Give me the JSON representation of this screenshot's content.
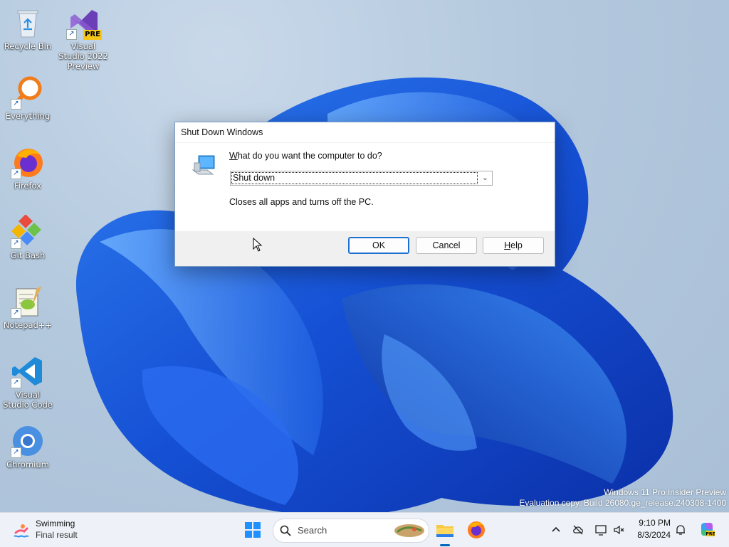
{
  "desktop": {
    "icons": [
      {
        "label": "Recycle Bin"
      },
      {
        "label": "Visual Studio 2022 Preview",
        "badge": "PRE"
      },
      {
        "label": "Everything"
      },
      {
        "label": "Firefox"
      },
      {
        "label": "Git Bash"
      },
      {
        "label": "Notepad++"
      },
      {
        "label": "Visual Studio Code"
      },
      {
        "label": "Chromium"
      }
    ]
  },
  "dialog": {
    "title": "Shut Down Windows",
    "prompt_pre": "W",
    "prompt_rest": "hat do you want the computer to do?",
    "selected_option": "Shut down",
    "description": "Closes all apps and turns off the PC.",
    "ok_label": "OK",
    "cancel_label": "Cancel",
    "help_label_ul": "H",
    "help_label_rest": "elp"
  },
  "watermark": {
    "line1": "Windows 11 Pro Insider Preview",
    "line2": "Evaluation copy. Build 26080.ge_release.240308-1400"
  },
  "taskbar": {
    "weather_title": "Swimming",
    "weather_subtitle": "Final result",
    "search_placeholder": "Search",
    "clock_time": "9:10 PM",
    "clock_date": "8/3/2024"
  },
  "colors": {
    "accent": "#0067c0",
    "default_button_border": "#1f6fd1",
    "wallpaper_blue": "#1a5bd6"
  }
}
